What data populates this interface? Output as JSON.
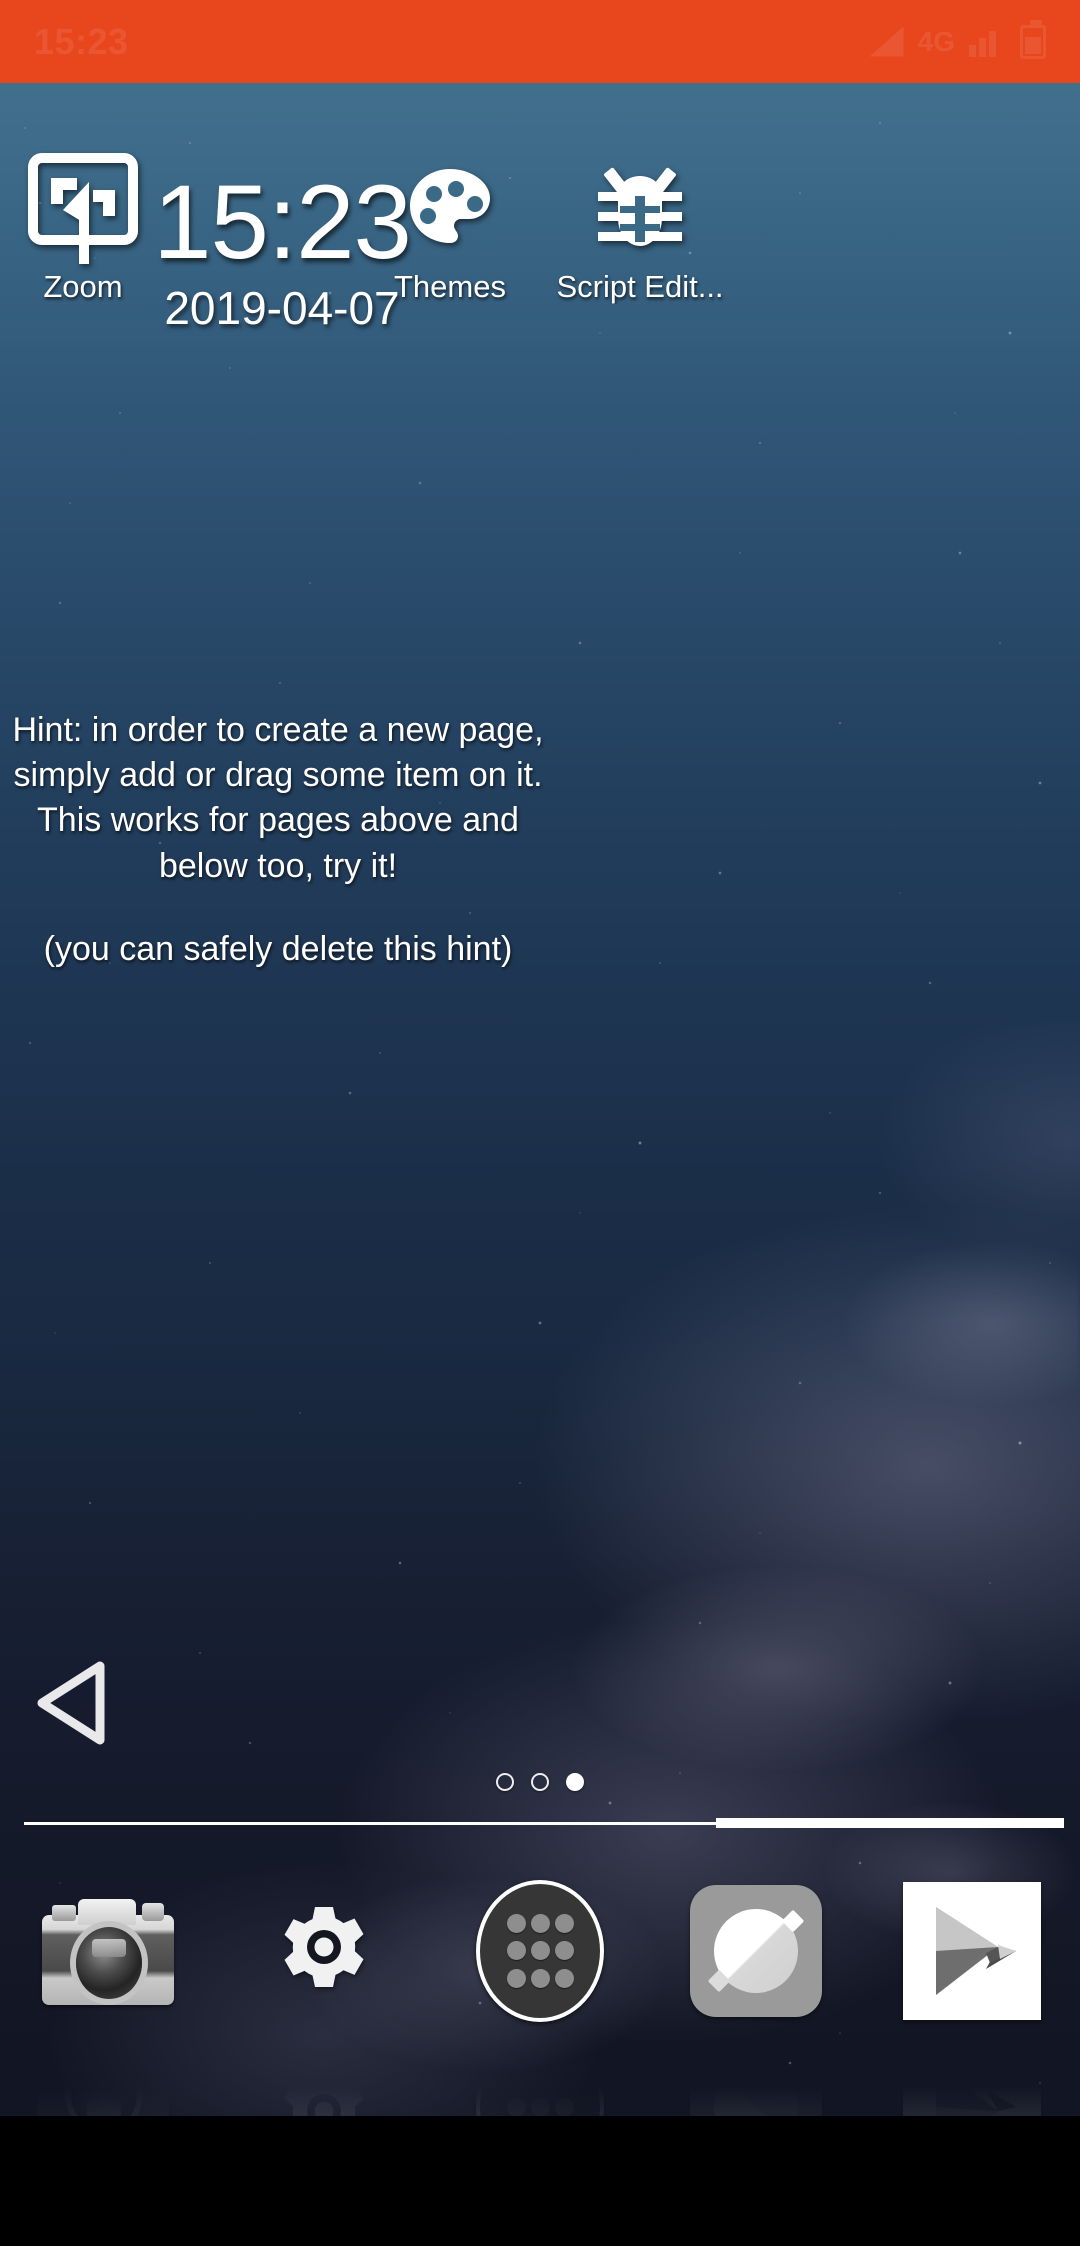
{
  "status_bar": {
    "time": "15:23",
    "network_label": "4G",
    "icons": [
      "signal-triangle-icon",
      "4g-icon",
      "signal-bars-icon",
      "battery-icon"
    ],
    "background_color": "#e8471e",
    "text_color": "#ffffff"
  },
  "clock_widget": {
    "time": "15:23",
    "date": "2019-04-07"
  },
  "home_icons": [
    {
      "label": "Zoom",
      "icon": "zoom-frame-icon"
    },
    {
      "label": "Themes",
      "icon": "palette-icon"
    },
    {
      "label": "Script Edit...",
      "icon": "bug-icon"
    }
  ],
  "hint_widget": {
    "line1": "Hint: in order to create a new page,",
    "line2": "simply add or drag some item on it.",
    "line3": "This works for pages above and",
    "line4": "below too, try it!",
    "line5": "(you can safely delete this hint)"
  },
  "navigation": {
    "back_icon": "back-triangle-icon"
  },
  "page_indicator": {
    "total": 3,
    "active_index": 2,
    "dots": [
      "page-dot-1",
      "page-dot-2",
      "page-dot-3"
    ]
  },
  "dock": {
    "items": [
      {
        "name": "camera",
        "icon": "camera-icon"
      },
      {
        "name": "settings",
        "icon": "gear-icon"
      },
      {
        "name": "app-drawer",
        "icon": "app-drawer-icon"
      },
      {
        "name": "browser",
        "icon": "browser-compass-icon"
      },
      {
        "name": "play-store",
        "icon": "play-store-icon"
      }
    ]
  },
  "colors": {
    "accent": "#e8471e",
    "wallpaper_top": "#41708d",
    "wallpaper_bottom": "#121523",
    "nav_bar": "#000000",
    "text": "#ffffff"
  }
}
